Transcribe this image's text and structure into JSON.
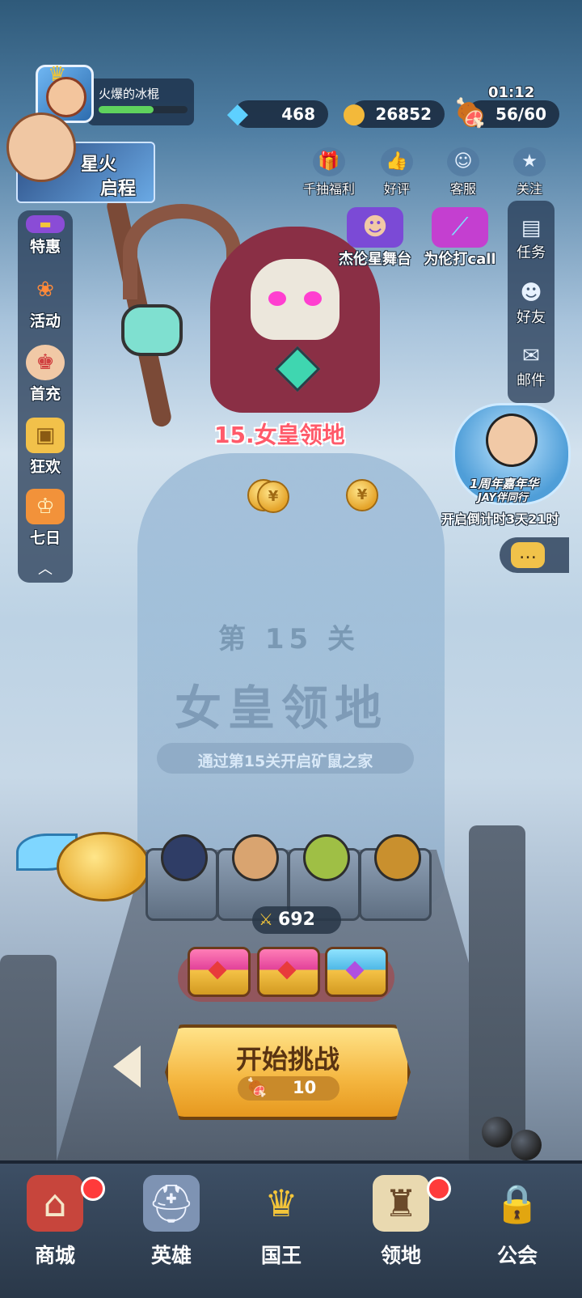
{
  "player": {
    "name": "火爆的冰棍",
    "xp_fraction": 0.62
  },
  "resources": {
    "gems": "468",
    "coins": "26852",
    "stamina": "56/60",
    "stamina_timer": "01:12"
  },
  "promo_banner": {
    "line1": "星火",
    "line2": "启程"
  },
  "top_icons": [
    {
      "label": "千抽福利",
      "icon": "gift-icon"
    },
    {
      "label": "好评",
      "icon": "thumbs-up-icon"
    },
    {
      "label": "客服",
      "icon": "headset-icon"
    },
    {
      "label": "关注",
      "icon": "star-badge-icon"
    }
  ],
  "left_menu": [
    {
      "label": "特惠",
      "icon": "banner-icon"
    },
    {
      "label": "活动",
      "icon": "fan-icon"
    },
    {
      "label": "首充",
      "icon": "princess-icon"
    },
    {
      "label": "狂欢",
      "icon": "treasure-chest-icon"
    },
    {
      "label": "七日",
      "icon": "crown-card-icon"
    }
  ],
  "right_menu": [
    {
      "label": "任务",
      "icon": "clipboard-icon"
    },
    {
      "label": "好友",
      "icon": "friends-icon"
    },
    {
      "label": "邮件",
      "icon": "mail-icon"
    }
  ],
  "events": [
    {
      "label": "杰伦星舞台",
      "icon": "stage-avatar-icon"
    },
    {
      "label": "为伦打call",
      "icon": "glowstick-icon"
    }
  ],
  "anniversary": {
    "line1": "1周年嘉年华",
    "line2": "JAY伴同行",
    "countdown": "开启倒计时3天21时"
  },
  "stage": {
    "title": "15.女皇领地",
    "watermark_level": "第 15 关",
    "watermark_name": "女皇领地",
    "unlock_hint": "通过第15关开启矿鼠之家"
  },
  "team": {
    "power": "692"
  },
  "start_button": {
    "label": "开始挑战",
    "cost": "10"
  },
  "bottom_nav": [
    {
      "label": "商城",
      "icon": "shop-stall-icon",
      "badge": true
    },
    {
      "label": "英雄",
      "icon": "knight-helmet-icon",
      "badge": false
    },
    {
      "label": "国王",
      "icon": "crown-icon",
      "badge": false
    },
    {
      "label": "领地",
      "icon": "castle-icon",
      "badge": true
    },
    {
      "label": "公会",
      "icon": "lock-icon",
      "badge": false
    }
  ],
  "colors": {
    "stage_title": "#ff5a6a",
    "button_gold": "#f4b53e",
    "nav_bg": "#2a3849",
    "badge": "#ff3b3b"
  }
}
